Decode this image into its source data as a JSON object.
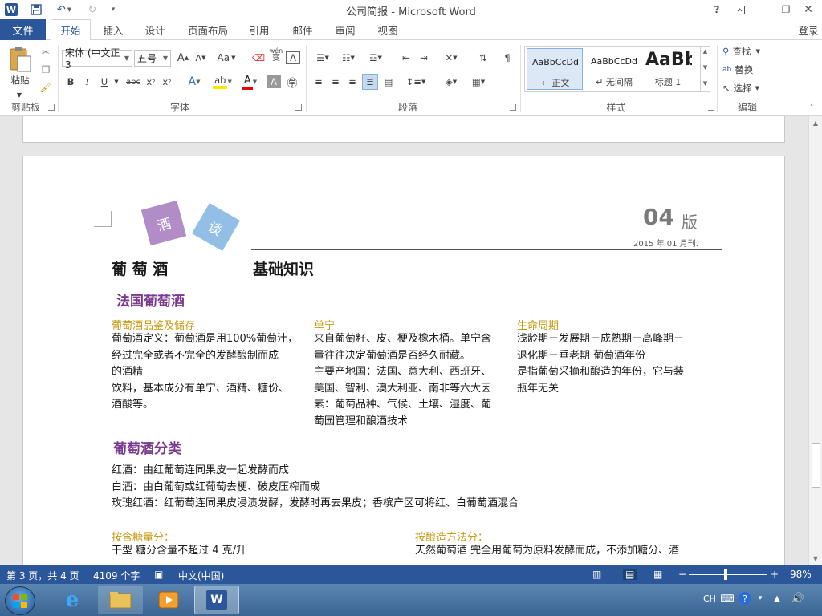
{
  "window": {
    "title": "公司简报 - Microsoft Word",
    "signin": "登录",
    "help": "?"
  },
  "tabs": {
    "file": "文件",
    "items": [
      "开始",
      "插入",
      "设计",
      "页面布局",
      "引用",
      "邮件",
      "审阅",
      "视图"
    ],
    "active": "开始"
  },
  "ribbon": {
    "clipboard": {
      "paste": "粘贴",
      "group": "剪贴板"
    },
    "font": {
      "name": "宋体 (中文正3",
      "size": "五号",
      "aa": "Aa",
      "wen": "wén",
      "a_box": "A",
      "group": "字体"
    },
    "paragraph": {
      "group": "段落"
    },
    "styles": {
      "group": "样式",
      "items": [
        {
          "sample": "AaBbCcDd",
          "name": "↵ 正文"
        },
        {
          "sample": "AaBbCcDd",
          "name": "↵ 无间隔"
        },
        {
          "sample": "AaBb",
          "name": "标题 1"
        }
      ]
    },
    "editing": {
      "find": "查找",
      "replace": "替换",
      "select": "选择",
      "group": "编辑"
    }
  },
  "document": {
    "badge1": "酒",
    "badge2": "谈",
    "issue_num": "04",
    "issue_suffix": "版",
    "date": "2015 年 01 月刊.",
    "heading_left": "葡 萄 酒",
    "heading_right": "基础知识",
    "section1": "法国葡萄酒",
    "col1_title": "葡萄酒品鉴及储存",
    "col1_lines": [
      "葡萄酒定义：葡萄酒是用100%葡萄汁，",
      "经过完全或者不完全的发酵酿制而成",
      "的酒精",
      "饮料，基本成分有单宁、酒精、糖份、",
      "酒酸等。"
    ],
    "col2_title": "单宁",
    "col2_lines": [
      "来自葡萄籽、皮、梗及橡木桶。单宁含",
      "量往往决定葡萄酒是否经久耐藏。",
      "主要产地国：法国、意大利、西班牙、",
      "美国、智利、澳大利亚、南非等六大因",
      "素：葡萄品种、气候、土壤、湿度、葡",
      "萄园管理和酿酒技术"
    ],
    "col3_title": "生命周期",
    "col3_lines": [
      "浅龄期－发展期－成熟期－高峰期－",
      "退化期－垂老期 葡萄酒年份",
      "是指葡萄采摘和酿造的年份，它与装",
      "瓶年无关"
    ],
    "section2": "葡萄酒分类",
    "class_lines": [
      "红酒：由红葡萄连同果皮一起发酵而成",
      "白酒：由白葡萄或红葡萄去梗、破皮压榨而成",
      "玫瑰红酒：红葡萄连同果皮浸渍发酵，发酵时再去果皮；香槟产区可将红、白葡萄酒混合"
    ],
    "sugar_title": "按含糖量分：",
    "sugar_line1": "干型  糖分含量不超过 4 克/升",
    "method_title": "按酿造方法分：",
    "method_line1": "天然葡萄酒  完全用葡萄为原料发酵而成，不添加糖分、酒"
  },
  "status": {
    "page": "第 3 页，共 4 页",
    "words": "4109 个字",
    "lang": "中文(中国)",
    "zoom": "98%"
  },
  "taskbar": {
    "ime": "CH"
  },
  "colors": {
    "accent": "#2b579a",
    "heading_purple": "#7a3a8e",
    "subtitle_gold": "#c79a12",
    "badge1": "#b18cc6",
    "badge2": "#93bfe6"
  }
}
